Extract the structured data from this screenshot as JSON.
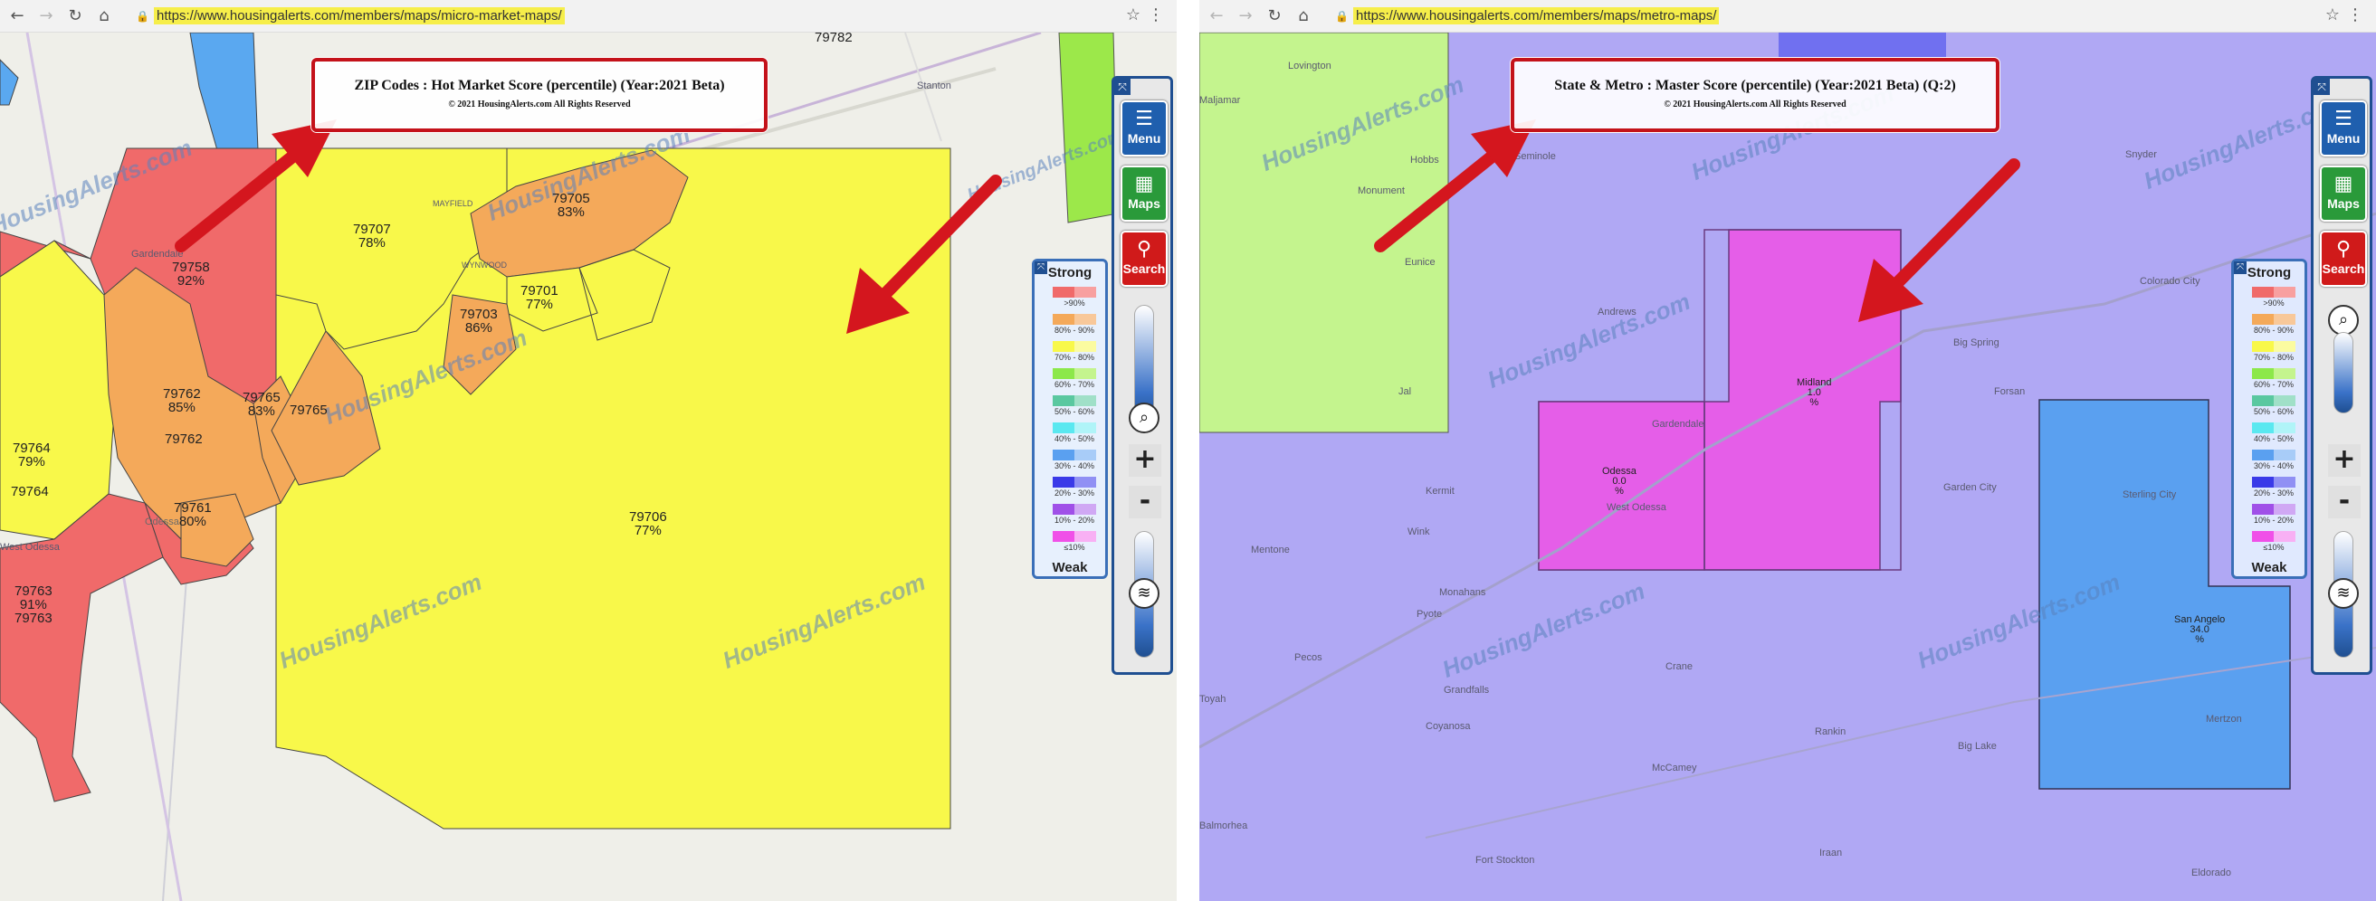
{
  "left": {
    "browser": {
      "url": "https://www.housingalerts.com/members/maps/micro-market-maps/"
    },
    "title": {
      "main": "ZIP Codes : Hot Market Score (percentile) (Year:2021 Beta)",
      "copyright": "© 2021 HousingAlerts.com All Rights Reserved"
    },
    "toolbar": {
      "menu": "Menu",
      "maps": "Maps",
      "search": "Search"
    },
    "legend": {
      "top": "Strong",
      "bottom": "Weak",
      "rows": [
        ">90%",
        "80% - 90%",
        "70% - 80%",
        "60% - 70%",
        "50% - 60%",
        "40% - 50%",
        "30% - 40%",
        "20% - 30%",
        "10% - 20%",
        "≤10%"
      ]
    },
    "zips": {
      "z79707": [
        "79707",
        "78%"
      ],
      "z79705": [
        "79705",
        "83%"
      ],
      "z79758": [
        "79758",
        "92%"
      ],
      "z79701": [
        "79701",
        "77%"
      ],
      "z79703": [
        "79703",
        "86%"
      ],
      "z79762a": [
        "79762",
        "85%"
      ],
      "z79765": [
        "79765",
        "83%"
      ],
      "z79765b": "79765",
      "z79762b": "79762",
      "z79764": [
        "79764",
        "79%"
      ],
      "z79764b": "79764",
      "z79761": [
        "79761",
        "80%"
      ],
      "z79706": [
        "79706",
        "77%"
      ],
      "z79763": [
        "79763",
        "91%"
      ],
      "z79763b": "79763",
      "z79782": "79782"
    },
    "places": {
      "stanton": "Stanton",
      "gardendale": "Gardendale",
      "westodessa": "West Odessa",
      "odessa": "Odessa",
      "mayfield": "MAYFIELD",
      "wynwood": "WYNWOOD"
    },
    "watermark": "HousingAlerts.com"
  },
  "right": {
    "browser": {
      "url": "https://www.housingalerts.com/members/maps/metro-maps/"
    },
    "title": {
      "main": "State & Metro : Master Score (percentile) (Year:2021 Beta) (Q:2)",
      "copyright": "© 2021 HousingAlerts.com All Rights Reserved"
    },
    "toolbar": {
      "menu": "Menu",
      "maps": "Maps",
      "search": "Search"
    },
    "legend": {
      "top": "Strong",
      "bottom": "Weak",
      "rows": [
        ">90%",
        "80% - 90%",
        "70% - 80%",
        "60% - 70%",
        "50% - 60%",
        "40% - 50%",
        "30% - 40%",
        "20% - 30%",
        "10% - 20%",
        "≤10%"
      ]
    },
    "metros": {
      "midland": [
        "Midland",
        "1.0",
        "%"
      ],
      "odessa": [
        "Odessa",
        "0.0",
        "%"
      ],
      "sanangelo": [
        "San Angelo",
        "34.0",
        "%"
      ]
    },
    "places": {
      "lovington": "Lovington",
      "maljamar": "Maljamar",
      "hobbs": "Hobbs",
      "monument": "Monument",
      "eunice": "Eunice",
      "jal": "Jal",
      "seminole": "Seminole",
      "andrews": "Andrews",
      "kermit": "Kermit",
      "wink": "Wink",
      "mentone": "Mentone",
      "monahans": "Monahans",
      "pyote": "Pyote",
      "pecos": "Pecos",
      "toyah": "Toyah",
      "grandfalls": "Grandfalls",
      "crane": "Crane",
      "coyanosa": "Coyanosa",
      "mccamey": "McCamey",
      "balmorhea": "Balmorhea",
      "fortstockton": "Fort Stockton",
      "iraan": "Iraan",
      "rankin": "Rankin",
      "biglake": "Big Lake",
      "eldorado": "Eldorado",
      "gardencity": "Garden City",
      "forsan": "Forsan",
      "bigspring": "Big Spring",
      "coloradocity": "Colorado City",
      "snyder": "Snyder",
      "sterlingcity": "Sterling City",
      "mertzon": "Mertzon",
      "gardendale": "Gardendale",
      "westodessa": "West Odessa"
    },
    "watermark": "HousingAlerts.com"
  },
  "colors": {
    "red": "#f06a6a",
    "orange": "#f4a95a",
    "yellow": "#f8f84a",
    "magenta": "#e55ee8",
    "lavender": "#b0a8f4",
    "blue": "#5aa0f0",
    "green": "#c4f48e",
    "titleborder": "#c4121a",
    "arrow": "#d4161e"
  }
}
